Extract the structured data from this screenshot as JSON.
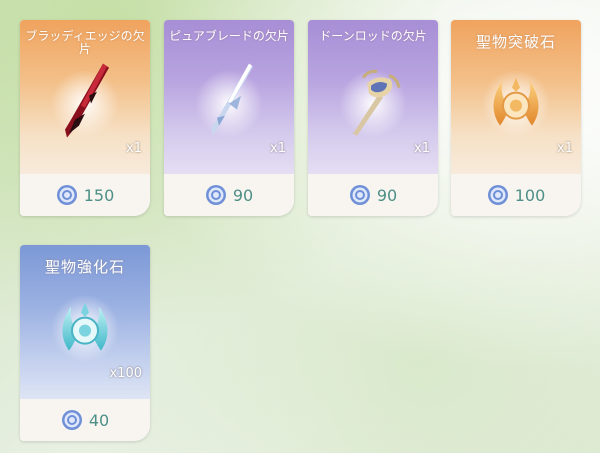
{
  "items": [
    {
      "name": "ブラッディエッジの欠片",
      "quantity": "x1",
      "price": "150",
      "icon": "blood-blade-fragment-icon",
      "rarity_color": "#f0a35e"
    },
    {
      "name": "ピュアブレードの欠片",
      "quantity": "x1",
      "price": "90",
      "icon": "pure-blade-fragment-icon",
      "rarity_color": "#a78ed6"
    },
    {
      "name": "ドーンロッドの欠片",
      "quantity": "x1",
      "price": "90",
      "icon": "dawn-rod-fragment-icon",
      "rarity_color": "#a78ed6"
    },
    {
      "name": "聖物突破石",
      "quantity": "x1",
      "price": "100",
      "icon": "relic-breakthrough-stone-icon",
      "rarity_color": "#f0a35e"
    },
    {
      "name": "聖物強化石",
      "quantity": "x100",
      "price": "40",
      "icon": "relic-enhancement-stone-icon",
      "rarity_color": "#7c98d6"
    }
  ],
  "currency_icon": "coin-icon",
  "price_color": "#4d8f86"
}
